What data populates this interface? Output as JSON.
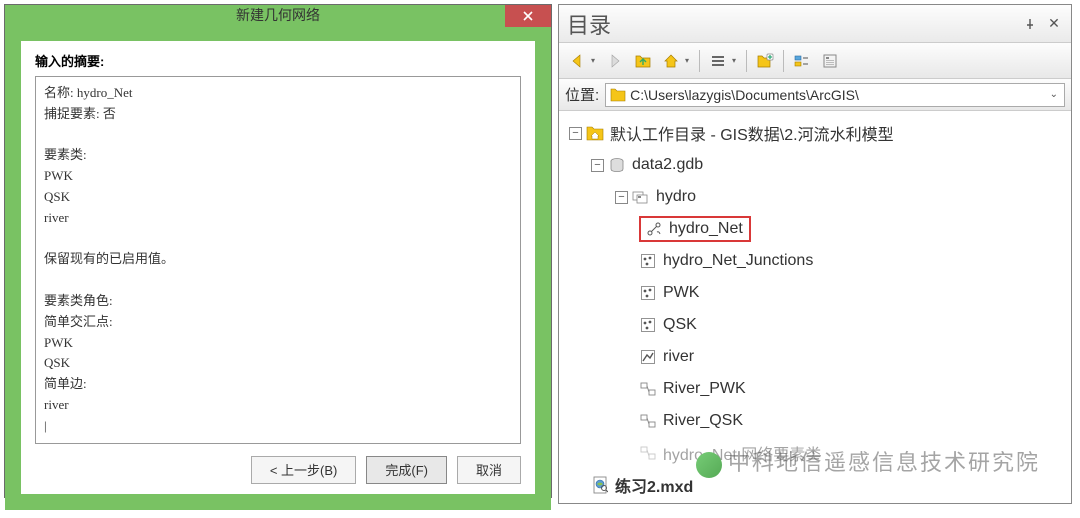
{
  "dialog": {
    "title": "新建几何网络",
    "summaryTitle": "输入的摘要:",
    "summary": "名称: hydro_Net\n捕捉要素: 否\n\n要素类:\n  PWK\n  QSK\n  river\n\n保留现有的已启用值。\n\n要素类角色:\n  简单交汇点:\n    PWK\n    QSK\n  简单边:\n    river\n|",
    "buttons": {
      "back": "< 上一步(B)",
      "finish": "完成(F)",
      "cancel": "取消"
    }
  },
  "catalog": {
    "title": "目录",
    "location": {
      "label": "位置:",
      "path": "C:\\Users\\lazygis\\Documents\\ArcGIS\\"
    },
    "tree": {
      "root": "默认工作目录 - GIS数据\\2.河流水利模型",
      "gdb": "data2.gdb",
      "dataset": "hydro",
      "items": [
        "hydro_Net",
        "hydro_Net_Junctions",
        "PWK",
        "QSK",
        "river",
        "River_PWK",
        "River_QSK",
        "hydro_Net 网络要素类"
      ],
      "mxd": "练习2.mxd"
    }
  },
  "watermark": "中科地信遥感信息技术研究院"
}
